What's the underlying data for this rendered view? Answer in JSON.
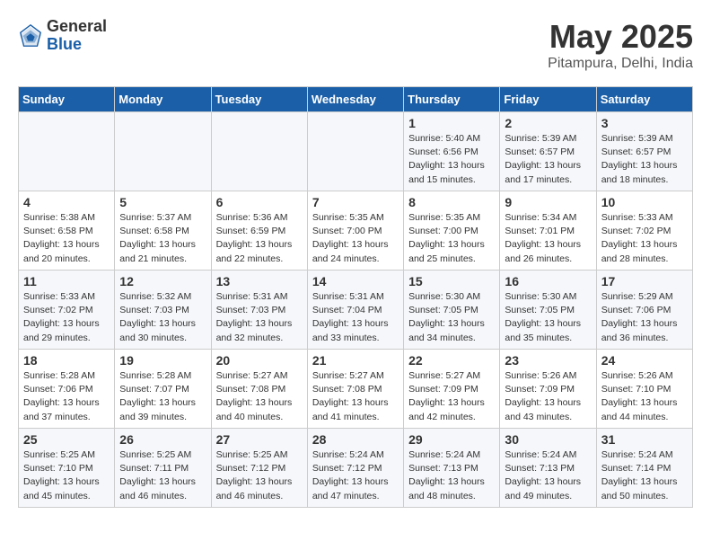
{
  "header": {
    "logo_general": "General",
    "logo_blue": "Blue",
    "title": "May 2025",
    "subtitle": "Pitampura, Delhi, India"
  },
  "days_of_week": [
    "Sunday",
    "Monday",
    "Tuesday",
    "Wednesday",
    "Thursday",
    "Friday",
    "Saturday"
  ],
  "weeks": [
    [
      {
        "day": "",
        "info": ""
      },
      {
        "day": "",
        "info": ""
      },
      {
        "day": "",
        "info": ""
      },
      {
        "day": "",
        "info": ""
      },
      {
        "day": "1",
        "info": "Sunrise: 5:40 AM\nSunset: 6:56 PM\nDaylight: 13 hours\nand 15 minutes."
      },
      {
        "day": "2",
        "info": "Sunrise: 5:39 AM\nSunset: 6:57 PM\nDaylight: 13 hours\nand 17 minutes."
      },
      {
        "day": "3",
        "info": "Sunrise: 5:39 AM\nSunset: 6:57 PM\nDaylight: 13 hours\nand 18 minutes."
      }
    ],
    [
      {
        "day": "4",
        "info": "Sunrise: 5:38 AM\nSunset: 6:58 PM\nDaylight: 13 hours\nand 20 minutes."
      },
      {
        "day": "5",
        "info": "Sunrise: 5:37 AM\nSunset: 6:58 PM\nDaylight: 13 hours\nand 21 minutes."
      },
      {
        "day": "6",
        "info": "Sunrise: 5:36 AM\nSunset: 6:59 PM\nDaylight: 13 hours\nand 22 minutes."
      },
      {
        "day": "7",
        "info": "Sunrise: 5:35 AM\nSunset: 7:00 PM\nDaylight: 13 hours\nand 24 minutes."
      },
      {
        "day": "8",
        "info": "Sunrise: 5:35 AM\nSunset: 7:00 PM\nDaylight: 13 hours\nand 25 minutes."
      },
      {
        "day": "9",
        "info": "Sunrise: 5:34 AM\nSunset: 7:01 PM\nDaylight: 13 hours\nand 26 minutes."
      },
      {
        "day": "10",
        "info": "Sunrise: 5:33 AM\nSunset: 7:02 PM\nDaylight: 13 hours\nand 28 minutes."
      }
    ],
    [
      {
        "day": "11",
        "info": "Sunrise: 5:33 AM\nSunset: 7:02 PM\nDaylight: 13 hours\nand 29 minutes."
      },
      {
        "day": "12",
        "info": "Sunrise: 5:32 AM\nSunset: 7:03 PM\nDaylight: 13 hours\nand 30 minutes."
      },
      {
        "day": "13",
        "info": "Sunrise: 5:31 AM\nSunset: 7:03 PM\nDaylight: 13 hours\nand 32 minutes."
      },
      {
        "day": "14",
        "info": "Sunrise: 5:31 AM\nSunset: 7:04 PM\nDaylight: 13 hours\nand 33 minutes."
      },
      {
        "day": "15",
        "info": "Sunrise: 5:30 AM\nSunset: 7:05 PM\nDaylight: 13 hours\nand 34 minutes."
      },
      {
        "day": "16",
        "info": "Sunrise: 5:30 AM\nSunset: 7:05 PM\nDaylight: 13 hours\nand 35 minutes."
      },
      {
        "day": "17",
        "info": "Sunrise: 5:29 AM\nSunset: 7:06 PM\nDaylight: 13 hours\nand 36 minutes."
      }
    ],
    [
      {
        "day": "18",
        "info": "Sunrise: 5:28 AM\nSunset: 7:06 PM\nDaylight: 13 hours\nand 37 minutes."
      },
      {
        "day": "19",
        "info": "Sunrise: 5:28 AM\nSunset: 7:07 PM\nDaylight: 13 hours\nand 39 minutes."
      },
      {
        "day": "20",
        "info": "Sunrise: 5:27 AM\nSunset: 7:08 PM\nDaylight: 13 hours\nand 40 minutes."
      },
      {
        "day": "21",
        "info": "Sunrise: 5:27 AM\nSunset: 7:08 PM\nDaylight: 13 hours\nand 41 minutes."
      },
      {
        "day": "22",
        "info": "Sunrise: 5:27 AM\nSunset: 7:09 PM\nDaylight: 13 hours\nand 42 minutes."
      },
      {
        "day": "23",
        "info": "Sunrise: 5:26 AM\nSunset: 7:09 PM\nDaylight: 13 hours\nand 43 minutes."
      },
      {
        "day": "24",
        "info": "Sunrise: 5:26 AM\nSunset: 7:10 PM\nDaylight: 13 hours\nand 44 minutes."
      }
    ],
    [
      {
        "day": "25",
        "info": "Sunrise: 5:25 AM\nSunset: 7:10 PM\nDaylight: 13 hours\nand 45 minutes."
      },
      {
        "day": "26",
        "info": "Sunrise: 5:25 AM\nSunset: 7:11 PM\nDaylight: 13 hours\nand 46 minutes."
      },
      {
        "day": "27",
        "info": "Sunrise: 5:25 AM\nSunset: 7:12 PM\nDaylight: 13 hours\nand 46 minutes."
      },
      {
        "day": "28",
        "info": "Sunrise: 5:24 AM\nSunset: 7:12 PM\nDaylight: 13 hours\nand 47 minutes."
      },
      {
        "day": "29",
        "info": "Sunrise: 5:24 AM\nSunset: 7:13 PM\nDaylight: 13 hours\nand 48 minutes."
      },
      {
        "day": "30",
        "info": "Sunrise: 5:24 AM\nSunset: 7:13 PM\nDaylight: 13 hours\nand 49 minutes."
      },
      {
        "day": "31",
        "info": "Sunrise: 5:24 AM\nSunset: 7:14 PM\nDaylight: 13 hours\nand 50 minutes."
      }
    ]
  ]
}
